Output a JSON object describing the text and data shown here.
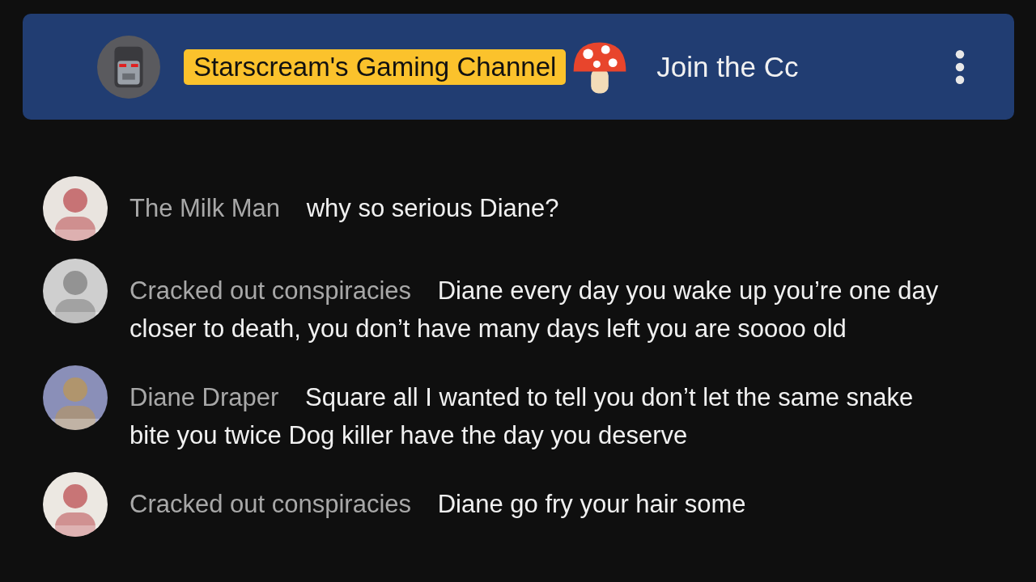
{
  "banner": {
    "channel_name": "Starscream's Gaming Channel",
    "message": "Join the Cc"
  },
  "messages": [
    {
      "author": "The Milk Man",
      "text": "why so serious Diane?"
    },
    {
      "author": "Cracked out conspiracies",
      "text": "Diane every day you wake up you’re one day closer to death, you don’t have many days left you are soooo old"
    },
    {
      "author": "Diane Draper",
      "text": "Square all I wanted to tell you don’t let the same snake bite you twice Dog killer have the day you deserve"
    },
    {
      "author": "Cracked out conspiracies",
      "text": "Diane go fry your hair some"
    }
  ]
}
